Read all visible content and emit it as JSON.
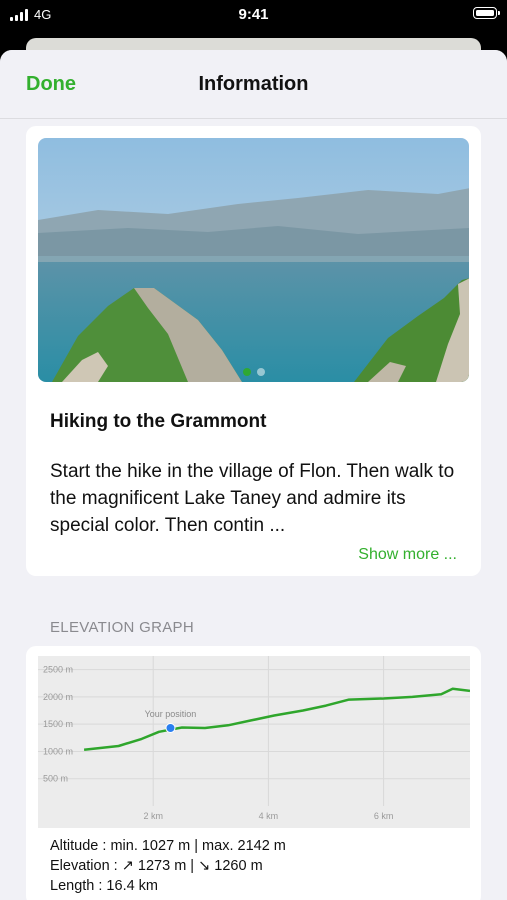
{
  "status_bar": {
    "carrier": "4G",
    "time": "9:41"
  },
  "nav": {
    "done_label": "Done",
    "title": "Information"
  },
  "hike": {
    "title": "Hiking to the Grammont",
    "description": "Start the hike in the village of Flon. Then walk to the magnificent Lake Taney and admire its special color. Then contin ...",
    "show_more": "Show more ...",
    "carousel": {
      "pages": 2,
      "active": 0
    }
  },
  "elevation": {
    "section_title": "ELEVATION GRAPH",
    "your_position_label": "Your position",
    "stats": {
      "altitude": "Altitude : min. 1027 m | max. 2142 m",
      "elevation": "Elevation : ↗ 1273 m | ↘ 1260 m",
      "length": "Length : 16.4 km"
    }
  },
  "chart_data": {
    "type": "line",
    "xlabel": "",
    "ylabel": "",
    "xlim": [
      0,
      7.5
    ],
    "ylim": [
      0,
      2750
    ],
    "x_ticks": [
      2,
      4,
      6
    ],
    "x_tick_labels": [
      "2 km",
      "4 km",
      "6 km"
    ],
    "y_ticks": [
      500,
      1000,
      1500,
      2000,
      2500
    ],
    "y_tick_labels": [
      "500 m",
      "1000 m",
      "1500 m",
      "2000 m",
      "2500 m"
    ],
    "grid": true,
    "line_color": "#2fa62c",
    "marker_color": "#2a7ff0",
    "series": [
      {
        "x": [
          0.8,
          1.4,
          1.8,
          2.1,
          2.5,
          2.9,
          3.3,
          3.7,
          4.1,
          4.6,
          5.0,
          5.4,
          6.0,
          6.5,
          7.0,
          7.2,
          7.5
        ],
        "y": [
          1030,
          1100,
          1230,
          1360,
          1440,
          1430,
          1480,
          1570,
          1660,
          1750,
          1840,
          1950,
          1970,
          2000,
          2050,
          2150,
          2110
        ]
      }
    ],
    "marker": {
      "x": 2.3,
      "y": 1430,
      "label": "Your position"
    }
  }
}
